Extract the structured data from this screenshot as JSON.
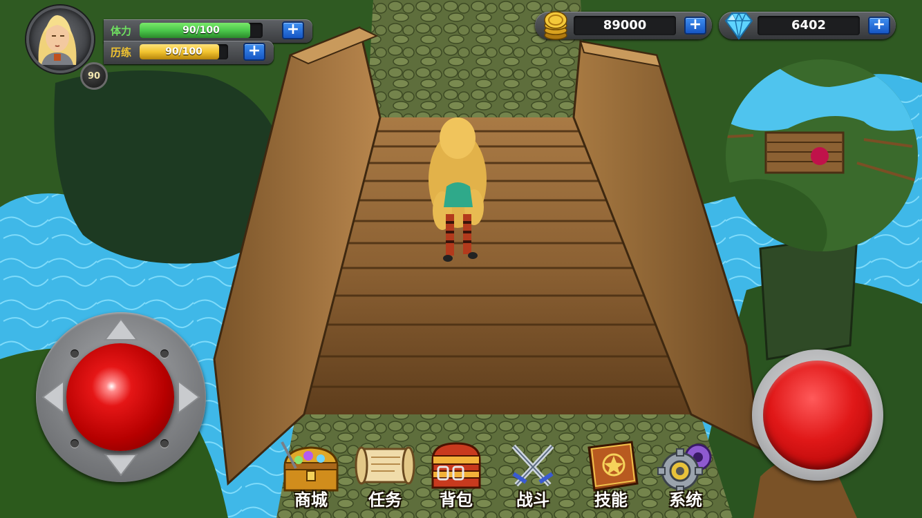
{
  "player": {
    "level": "90",
    "stamina": {
      "label": "体力",
      "text": "90/100",
      "fraction": 0.9,
      "color": "#4bc84b"
    },
    "experience": {
      "label": "历练",
      "text": "90/100",
      "fraction": 0.9,
      "color": "#f2c430"
    }
  },
  "currency": {
    "gold": {
      "value": "89000",
      "icon": "gold-coins-icon"
    },
    "diamond": {
      "value": "6402",
      "icon": "diamond-icon"
    }
  },
  "plus_symbol": "+",
  "menu": [
    {
      "label": "商城",
      "icon": "treasure-chest-icon"
    },
    {
      "label": "任务",
      "icon": "scroll-icon"
    },
    {
      "label": "背包",
      "icon": "backpack-icon"
    },
    {
      "label": "战斗",
      "icon": "crossed-swords-icon"
    },
    {
      "label": "技能",
      "icon": "spellbook-icon"
    },
    {
      "label": "系统",
      "icon": "gears-icon"
    }
  ],
  "controls": {
    "joystick": "virtual-joystick",
    "attack": "attack-button"
  },
  "colors": {
    "accent_blue": "#1f6fe0",
    "stamina_green": "#4bc84b",
    "experience_yellow": "#f2c430",
    "button_red": "#e01818"
  }
}
